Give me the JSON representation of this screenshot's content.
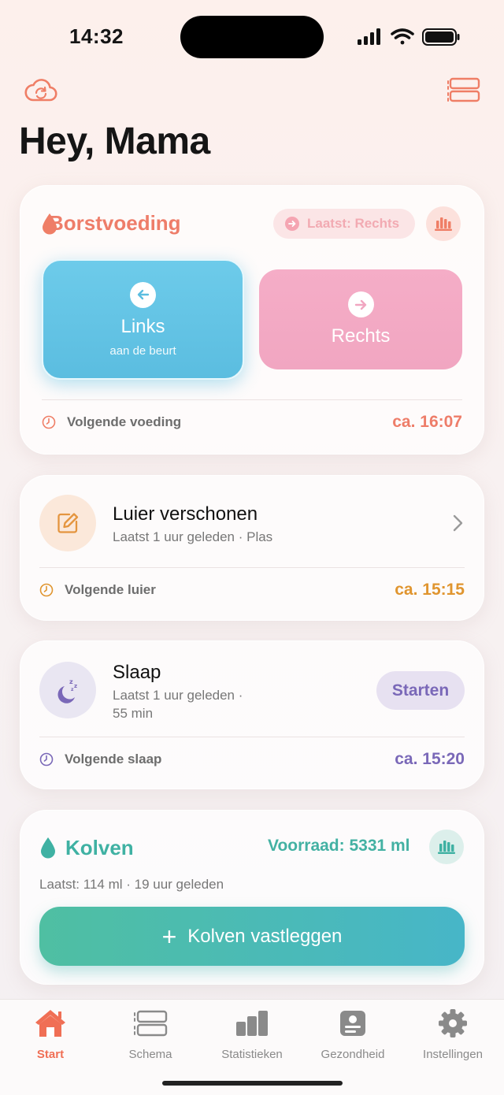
{
  "status": {
    "time": "14:32"
  },
  "greeting": "Hey, Mama",
  "feeding": {
    "title": "Borstvoeding",
    "last_side": "Laatst: Rechts",
    "left_label": "Links",
    "left_sub": "aan de beurt",
    "right_label": "Rechts",
    "next_label": "Volgende voeding",
    "next_time": "ca. 16:07",
    "accent": "#ee7d69"
  },
  "diaper": {
    "title": "Luier verschonen",
    "subtitle": "Laatst 1 uur geleden · Plas",
    "next_label": "Volgende luier",
    "next_time": "ca. 15:15",
    "accent": "#e0952f"
  },
  "sleep": {
    "title": "Slaap",
    "subtitle_line1": "Laatst 1 uur geleden ·",
    "subtitle_line2": "55 min",
    "start_label": "Starten",
    "next_label": "Volgende slaap",
    "next_time": "ca. 15:20",
    "accent": "#7a68b8"
  },
  "pumping": {
    "title": "Kolven",
    "stock": "Voorraad: 5331 ml",
    "last": "Laatst: 114 ml · 19 uur geleden",
    "record_label": "Kolven vastleggen",
    "accent": "#3fb1a3"
  },
  "tabs": [
    {
      "label": "Start",
      "icon": "home-icon",
      "active": true
    },
    {
      "label": "Schema",
      "icon": "schedule-icon"
    },
    {
      "label": "Statistieken",
      "icon": "bar-chart-icon"
    },
    {
      "label": "Gezondheid",
      "icon": "health-icon"
    },
    {
      "label": "Instellingen",
      "icon": "gear-icon"
    }
  ]
}
